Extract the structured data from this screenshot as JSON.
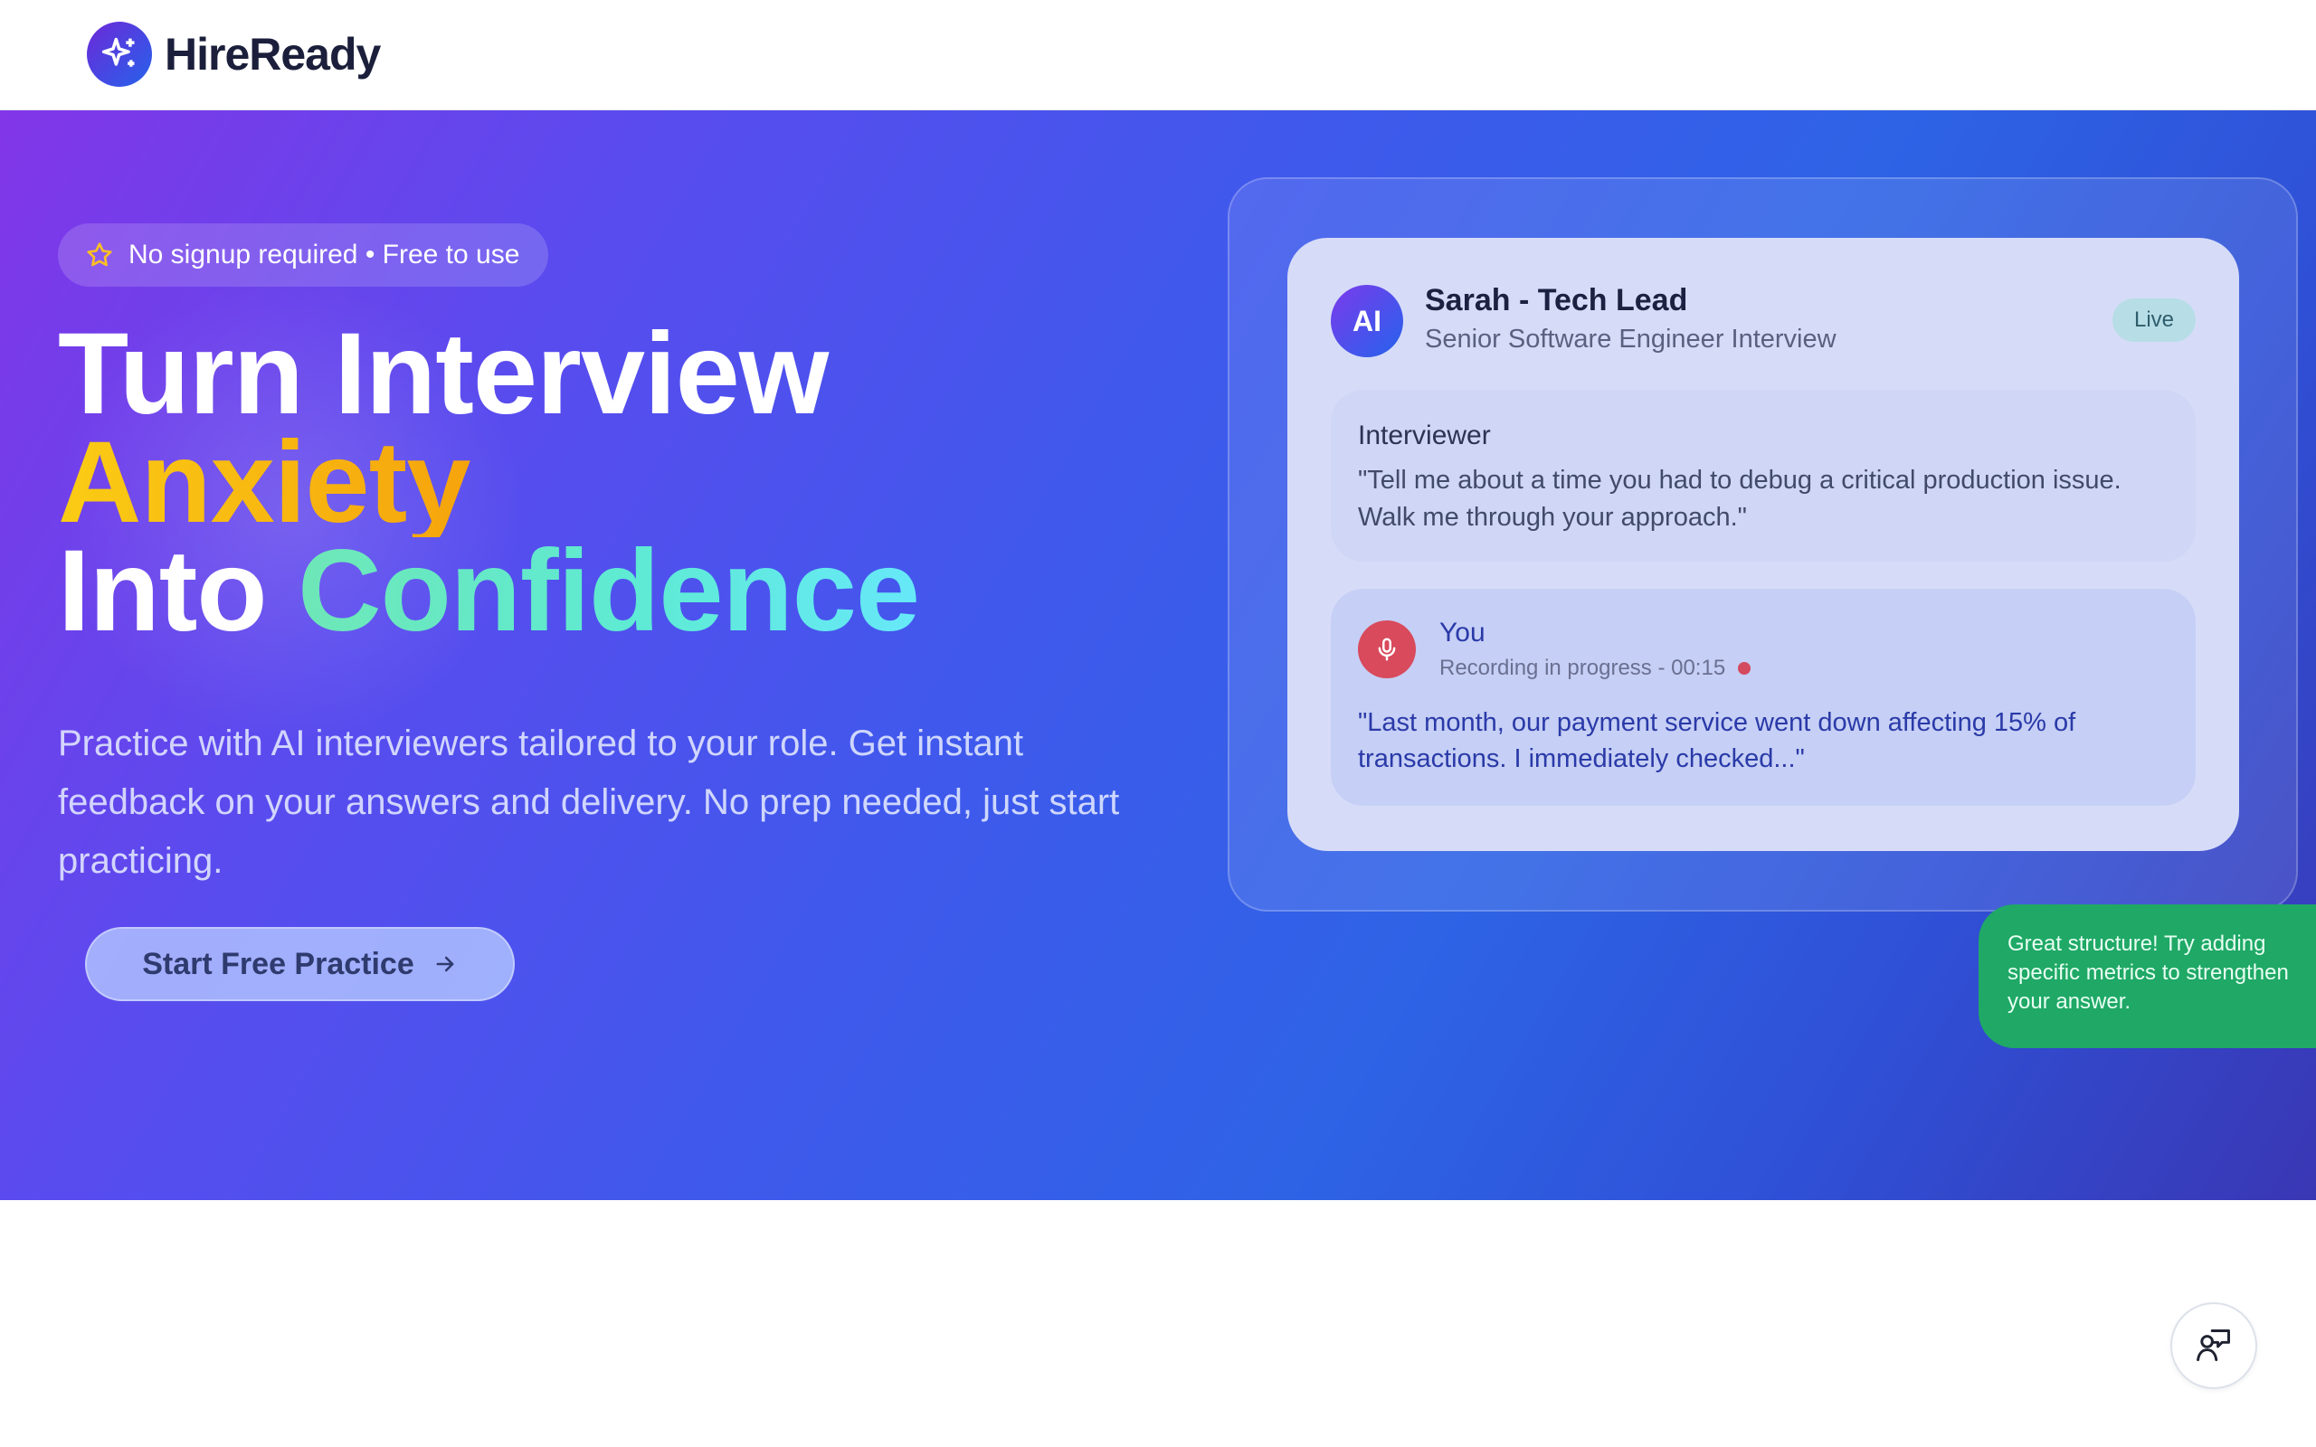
{
  "header": {
    "brand": "HireReady",
    "logo_icon": "sparkle-icon"
  },
  "hero": {
    "badge": "No signup required • Free to use",
    "badge_icon": "star-icon",
    "headline": {
      "line1": "Turn Interview",
      "line2": "Anxiety",
      "line3_prefix": "Into ",
      "line3_highlight": "Confidence"
    },
    "subtitle": "Practice with AI interviewers tailored to your role. Get instant feedback on your answers and delivery. No prep needed, just start practicing.",
    "cta_label": "Start Free Practice",
    "cta_icon": "arrow-right-icon"
  },
  "demo": {
    "avatar_initials": "AI",
    "interviewer_name": "Sarah - Tech Lead",
    "interview_title": "Senior Software Engineer Interview",
    "status_badge": "Live",
    "question_label": "Interviewer",
    "question_text": "\"Tell me about a time you had to debug a critical production issue. Walk me through your approach.\"",
    "user_label": "You",
    "recording_status": "Recording in progress - 00:15",
    "answer_text": "\"Last month, our payment service went down affecting 15% of transactions. I immediately checked...\"",
    "feedback_text": "Great structure! Try adding specific metrics to strengthen your answer.",
    "mic_icon": "microphone-icon"
  },
  "help_button_icon": "feedback-chat-icon",
  "colors": {
    "brand_gradient_start": "#8236e8",
    "brand_gradient_end": "#2f63e6",
    "feedback_green": "#1fa866",
    "recording_red": "#d84a5c"
  }
}
